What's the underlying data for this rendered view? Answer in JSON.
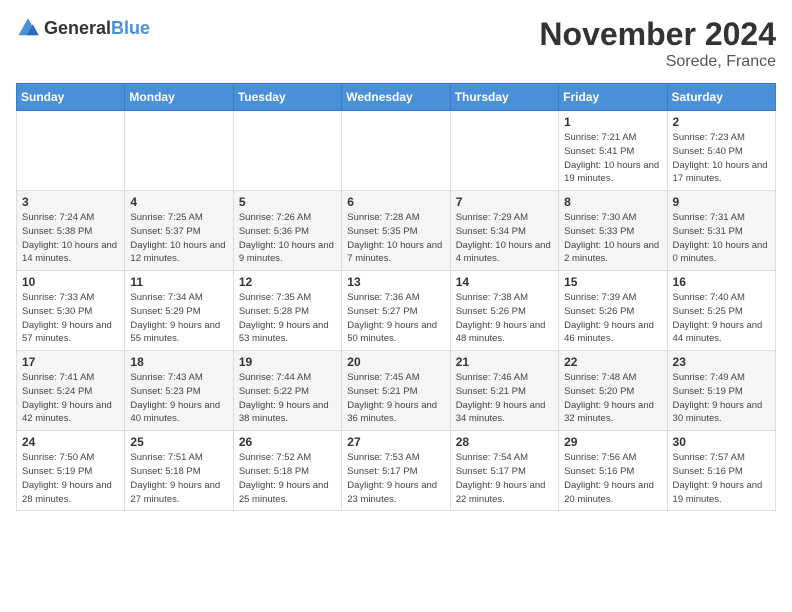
{
  "logo": {
    "general": "General",
    "blue": "Blue"
  },
  "title": "November 2024",
  "subtitle": "Sorede, France",
  "days_of_week": [
    "Sunday",
    "Monday",
    "Tuesday",
    "Wednesday",
    "Thursday",
    "Friday",
    "Saturday"
  ],
  "weeks": [
    [
      {
        "day": "",
        "info": ""
      },
      {
        "day": "",
        "info": ""
      },
      {
        "day": "",
        "info": ""
      },
      {
        "day": "",
        "info": ""
      },
      {
        "day": "",
        "info": ""
      },
      {
        "day": "1",
        "info": "Sunrise: 7:21 AM\nSunset: 5:41 PM\nDaylight: 10 hours and 19 minutes."
      },
      {
        "day": "2",
        "info": "Sunrise: 7:23 AM\nSunset: 5:40 PM\nDaylight: 10 hours and 17 minutes."
      }
    ],
    [
      {
        "day": "3",
        "info": "Sunrise: 7:24 AM\nSunset: 5:38 PM\nDaylight: 10 hours and 14 minutes."
      },
      {
        "day": "4",
        "info": "Sunrise: 7:25 AM\nSunset: 5:37 PM\nDaylight: 10 hours and 12 minutes."
      },
      {
        "day": "5",
        "info": "Sunrise: 7:26 AM\nSunset: 5:36 PM\nDaylight: 10 hours and 9 minutes."
      },
      {
        "day": "6",
        "info": "Sunrise: 7:28 AM\nSunset: 5:35 PM\nDaylight: 10 hours and 7 minutes."
      },
      {
        "day": "7",
        "info": "Sunrise: 7:29 AM\nSunset: 5:34 PM\nDaylight: 10 hours and 4 minutes."
      },
      {
        "day": "8",
        "info": "Sunrise: 7:30 AM\nSunset: 5:33 PM\nDaylight: 10 hours and 2 minutes."
      },
      {
        "day": "9",
        "info": "Sunrise: 7:31 AM\nSunset: 5:31 PM\nDaylight: 10 hours and 0 minutes."
      }
    ],
    [
      {
        "day": "10",
        "info": "Sunrise: 7:33 AM\nSunset: 5:30 PM\nDaylight: 9 hours and 57 minutes."
      },
      {
        "day": "11",
        "info": "Sunrise: 7:34 AM\nSunset: 5:29 PM\nDaylight: 9 hours and 55 minutes."
      },
      {
        "day": "12",
        "info": "Sunrise: 7:35 AM\nSunset: 5:28 PM\nDaylight: 9 hours and 53 minutes."
      },
      {
        "day": "13",
        "info": "Sunrise: 7:36 AM\nSunset: 5:27 PM\nDaylight: 9 hours and 50 minutes."
      },
      {
        "day": "14",
        "info": "Sunrise: 7:38 AM\nSunset: 5:26 PM\nDaylight: 9 hours and 48 minutes."
      },
      {
        "day": "15",
        "info": "Sunrise: 7:39 AM\nSunset: 5:26 PM\nDaylight: 9 hours and 46 minutes."
      },
      {
        "day": "16",
        "info": "Sunrise: 7:40 AM\nSunset: 5:25 PM\nDaylight: 9 hours and 44 minutes."
      }
    ],
    [
      {
        "day": "17",
        "info": "Sunrise: 7:41 AM\nSunset: 5:24 PM\nDaylight: 9 hours and 42 minutes."
      },
      {
        "day": "18",
        "info": "Sunrise: 7:43 AM\nSunset: 5:23 PM\nDaylight: 9 hours and 40 minutes."
      },
      {
        "day": "19",
        "info": "Sunrise: 7:44 AM\nSunset: 5:22 PM\nDaylight: 9 hours and 38 minutes."
      },
      {
        "day": "20",
        "info": "Sunrise: 7:45 AM\nSunset: 5:21 PM\nDaylight: 9 hours and 36 minutes."
      },
      {
        "day": "21",
        "info": "Sunrise: 7:46 AM\nSunset: 5:21 PM\nDaylight: 9 hours and 34 minutes."
      },
      {
        "day": "22",
        "info": "Sunrise: 7:48 AM\nSunset: 5:20 PM\nDaylight: 9 hours and 32 minutes."
      },
      {
        "day": "23",
        "info": "Sunrise: 7:49 AM\nSunset: 5:19 PM\nDaylight: 9 hours and 30 minutes."
      }
    ],
    [
      {
        "day": "24",
        "info": "Sunrise: 7:50 AM\nSunset: 5:19 PM\nDaylight: 9 hours and 28 minutes."
      },
      {
        "day": "25",
        "info": "Sunrise: 7:51 AM\nSunset: 5:18 PM\nDaylight: 9 hours and 27 minutes."
      },
      {
        "day": "26",
        "info": "Sunrise: 7:52 AM\nSunset: 5:18 PM\nDaylight: 9 hours and 25 minutes."
      },
      {
        "day": "27",
        "info": "Sunrise: 7:53 AM\nSunset: 5:17 PM\nDaylight: 9 hours and 23 minutes."
      },
      {
        "day": "28",
        "info": "Sunrise: 7:54 AM\nSunset: 5:17 PM\nDaylight: 9 hours and 22 minutes."
      },
      {
        "day": "29",
        "info": "Sunrise: 7:56 AM\nSunset: 5:16 PM\nDaylight: 9 hours and 20 minutes."
      },
      {
        "day": "30",
        "info": "Sunrise: 7:57 AM\nSunset: 5:16 PM\nDaylight: 9 hours and 19 minutes."
      }
    ]
  ]
}
